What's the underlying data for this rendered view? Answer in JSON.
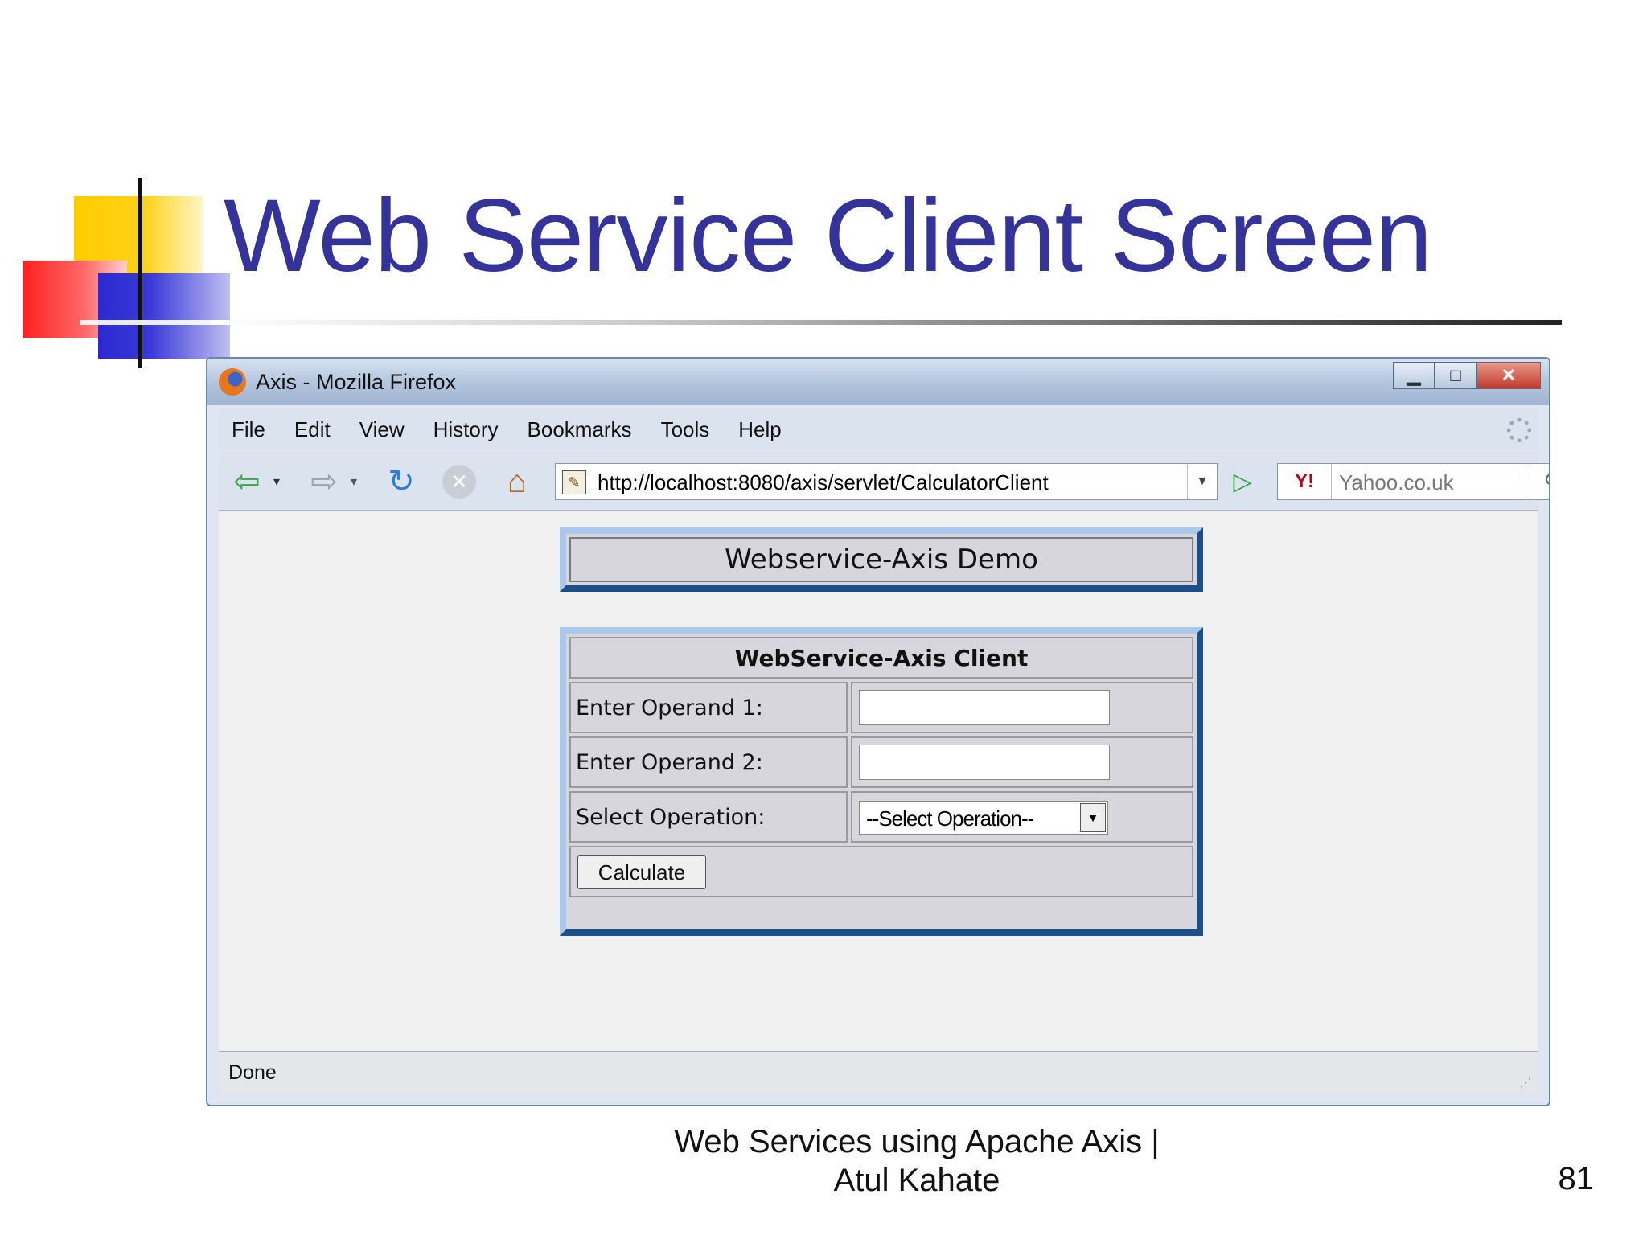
{
  "slide": {
    "title": "Web Service Client Screen",
    "footer_line1": "Web Services using Apache Axis |",
    "footer_line2": "Atul Kahate",
    "page_number": "81"
  },
  "window": {
    "title": "Axis - Mozilla Firefox",
    "menu": [
      "File",
      "Edit",
      "View",
      "History",
      "Bookmarks",
      "Tools",
      "Help"
    ]
  },
  "toolbar": {
    "url": "http://localhost:8080/axis/servlet/CalculatorClient",
    "search_engine": "Y!",
    "search_placeholder": "Yahoo.co.uk"
  },
  "page": {
    "demo_heading": "Webservice-Axis Demo",
    "client_heading": "WebService-Axis Client",
    "operand1_label": "Enter Operand 1:",
    "operand1_value": "",
    "operand2_label": "Enter Operand 2:",
    "operand2_value": "",
    "operation_label": "Select Operation:",
    "operation_selected": "--Select Operation--",
    "calculate_label": "Calculate"
  },
  "status": {
    "text": "Done"
  },
  "icons": [
    "firefox-icon",
    "minimize-icon",
    "maximize-icon",
    "close-icon",
    "throbber-icon",
    "back-icon",
    "forward-icon",
    "reload-icon",
    "stop-icon",
    "home-icon",
    "page-favicon",
    "go-icon",
    "search-icon"
  ]
}
